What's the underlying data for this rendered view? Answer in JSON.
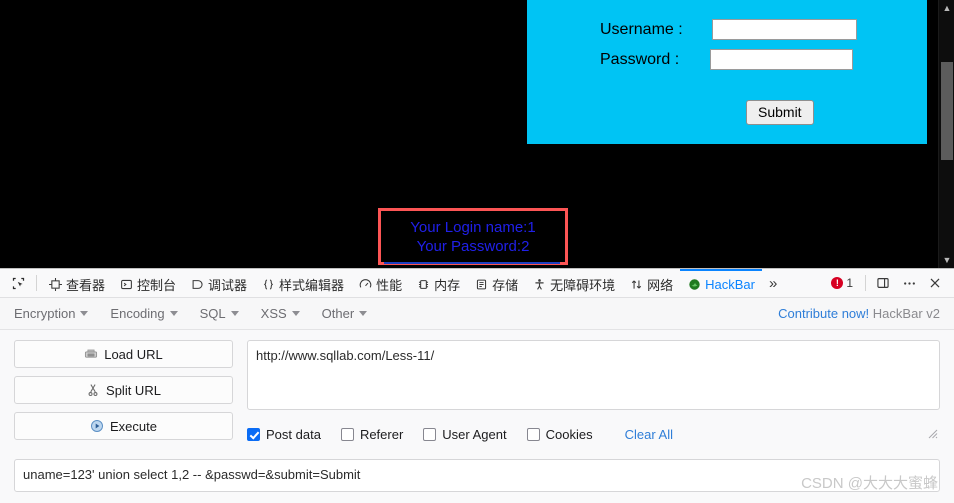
{
  "page": {
    "login_form": {
      "username_label": "Username :",
      "password_label": "Password :",
      "username_value": "",
      "password_value": "",
      "submit_label": "Submit",
      "background_color": "#00c4f4"
    },
    "result": {
      "line1": "Your Login name:1",
      "line2": "Your Password:2",
      "text_color": "#2020e8",
      "highlight_box_color": "#fc5555"
    },
    "background_color": "#000000"
  },
  "devtools": {
    "picker_icon": "element-picker-icon",
    "tabs": [
      {
        "label": "查看器",
        "icon": "inspector-icon",
        "active": false
      },
      {
        "label": "控制台",
        "icon": "console-icon",
        "active": false
      },
      {
        "label": "调试器",
        "icon": "debugger-icon",
        "active": false
      },
      {
        "label": "样式编辑器",
        "icon": "style-editor-icon",
        "active": false
      },
      {
        "label": "性能",
        "icon": "performance-icon",
        "active": false
      },
      {
        "label": "内存",
        "icon": "memory-icon",
        "active": false
      },
      {
        "label": "存储",
        "icon": "storage-icon",
        "active": false
      },
      {
        "label": "无障碍环境",
        "icon": "accessibility-icon",
        "active": false
      },
      {
        "label": "网络",
        "icon": "network-icon",
        "active": false
      },
      {
        "label": "HackBar",
        "icon": "hackbar-icon",
        "active": true
      }
    ],
    "overflow_label": "»",
    "error_count": "1",
    "dock_icon": "dock-to-side-icon",
    "meatball_icon": "more-options-icon",
    "close_icon": "close-icon",
    "accent_color": "#0a84ff",
    "error_color": "#d70022"
  },
  "hackbar": {
    "menus": [
      {
        "label": "Encryption"
      },
      {
        "label": "Encoding"
      },
      {
        "label": "SQL"
      },
      {
        "label": "XSS"
      },
      {
        "label": "Other"
      }
    ],
    "contribute_link": "Contribute now!",
    "version_label": "HackBar v2",
    "buttons": [
      {
        "label": "Load URL",
        "icon": "load-url-icon"
      },
      {
        "label": "Split URL",
        "icon": "scissors-icon"
      },
      {
        "label": "Execute",
        "icon": "execute-play-icon"
      }
    ],
    "url_value": "http://www.sqllab.com/Less-11/",
    "url_placeholder": "",
    "options": [
      {
        "label": "Post data",
        "checked": true
      },
      {
        "label": "Referer",
        "checked": false
      },
      {
        "label": "User Agent",
        "checked": false
      },
      {
        "label": "Cookies",
        "checked": false
      }
    ],
    "clear_all_label": "Clear All",
    "post_data_value": "uname=123' union select 1,2 -- &passwd=&submit=Submit",
    "link_color": "#2f7ed8"
  },
  "watermark": {
    "text": "CSDN @大大大蜜蜂"
  }
}
